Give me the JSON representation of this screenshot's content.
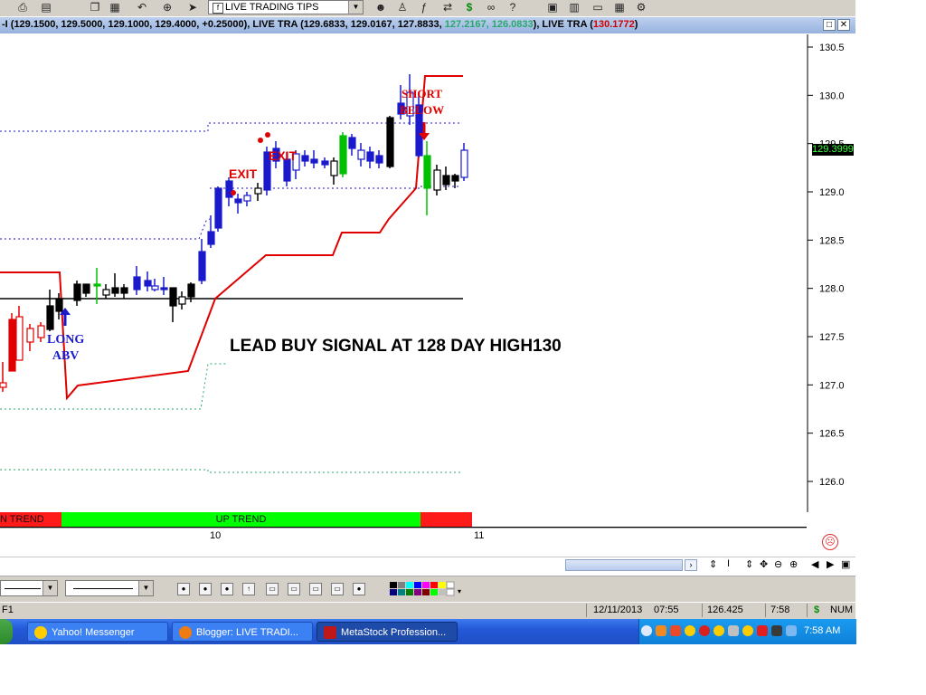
{
  "toolbar": {
    "chart_select_value": "LIVE TRADING TIPS",
    "icons": [
      "print-icon",
      "print-preview-icon",
      "copy-icon",
      "paste-icon",
      "undo-icon",
      "crosshair-icon",
      "pointer-icon",
      "expert-icon",
      "formula-icon",
      "function-icon",
      "dollar-icon",
      "binoculars-icon",
      "help-icon",
      "tile-icon",
      "cascade-icon",
      "window-icon",
      "arrange-icon",
      "settings-icon"
    ]
  },
  "titlebar": {
    "text_part1": "-I (129.1500, 129.5000, 129.1000, 129.4000, +0.25000), LIVE TRA (129.6833, 129.0167, ",
    "text_part2": "127.8833, ",
    "text_part3": "127.2167, 126.0833",
    "text_part4": "), LIVE TRA (",
    "text_part5": "130.1772",
    "text_part6": ")",
    "minimize_label": "□",
    "close_label": "✕"
  },
  "chart": {
    "annotations": {
      "lead_signal": "LEAD BUY SIGNAL AT 128 DAY HIGH130",
      "long_line1": "LONG",
      "long_line2": "ABV",
      "short_line1": "SHORT",
      "short_line2": "BELOW",
      "exit1": "EXIT",
      "exit2": "EXIT"
    },
    "price_tag": "129.3999"
  },
  "chart_data": {
    "type": "candlestick",
    "y_axis": {
      "ticks": [
        "130.5",
        "130.0",
        "129.5",
        "129.0",
        "128.5",
        "128.0",
        "127.5",
        "127.0",
        "126.5",
        "126.0"
      ],
      "ylim": [
        125.9,
        130.6
      ]
    },
    "x_axis": {
      "labels": [
        "10",
        "11"
      ]
    },
    "current_price": 129.3999,
    "trend_labels": [
      "N TREND",
      "UP TREND"
    ],
    "colors": {
      "up_trend": "#00ff00",
      "down_trend": "#ff0000",
      "stop_line": "#ff0000",
      "support_line": "#000000"
    }
  },
  "trend": {
    "down_label": "N TREND",
    "up_label": "UP TREND"
  },
  "axis": {
    "label_10": "10",
    "label_11": "11"
  },
  "status": {
    "left": "F1",
    "date": "12/11/2013",
    "time1": "07:55",
    "price": "126.425",
    "time2": "7:58",
    "currency": "$",
    "num": "NUM"
  },
  "taskbar": {
    "tasks": [
      {
        "label": "Yahoo! Messenger"
      },
      {
        "label": "Blogger: LIVE TRADI..."
      },
      {
        "label": "MetaStock Profession..."
      }
    ],
    "clock": "7:58 AM"
  }
}
